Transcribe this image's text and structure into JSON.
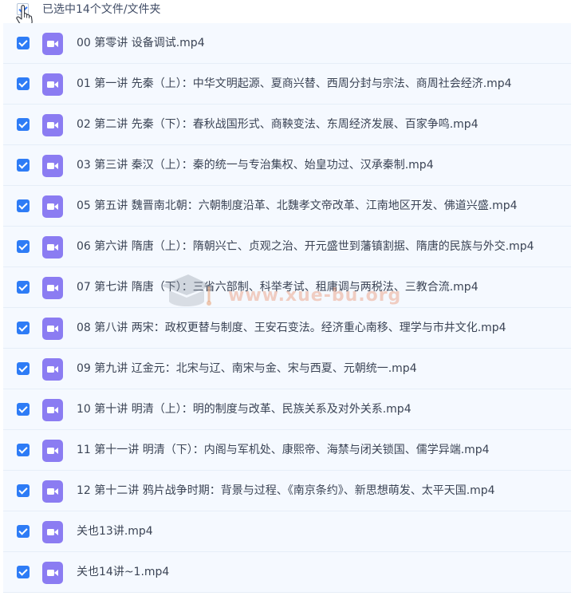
{
  "header": {
    "selection_text": "已选中14个文件/文件夹"
  },
  "files": [
    {
      "name": "00 第零讲 设备调试.mp4"
    },
    {
      "name": "01 第一讲 先秦（上）：中华文明起源、夏商兴替、西周分封与宗法、商周社会经济.mp4"
    },
    {
      "name": "02 第二讲 先秦（下）：春秋战国形式、商鞅变法、东周经济发展、百家争鸣.mp4"
    },
    {
      "name": "03 第三讲 秦汉（上）：秦的统一与专治集权、始皇功过、汉承秦制.mp4"
    },
    {
      "name": "05 第五讲 魏晋南北朝：六朝制度沿革、北魏孝文帝改革、江南地区开发、佛道兴盛.mp4"
    },
    {
      "name": "06 第六讲 隋唐（上）：隋朝兴亡、贞观之治、开元盛世到藩镇割据、隋唐的民族与外交.mp4"
    },
    {
      "name": "07 第七讲 隋唐（下）：三省六部制、科举考试、租庸调与两税法、三教合流.mp4"
    },
    {
      "name": "08 第八讲 两宋：政权更替与制度、王安石变法。经济重心南移、理学与市井文化.mp4"
    },
    {
      "name": "09 第九讲 辽金元：北宋与辽、南宋与金、宋与西夏、元朝统一.mp4"
    },
    {
      "name": "10 第十讲 明清（上）：明的制度与改革、民族关系及对外关系.mp4"
    },
    {
      "name": "11 第十一讲 明清（下）：内阁与军机处、康熙帝、海禁与闭关锁国、儒学异端.mp4"
    },
    {
      "name": "12 第十二讲 鸦片战争时期：背景与过程、《南京条约》、新思想萌发、太平天国.mp4"
    },
    {
      "name": "关也13讲.mp4"
    },
    {
      "name": "关也14讲~1.mp4"
    }
  ],
  "watermark": {
    "text": "www.xue-bu.org"
  },
  "colors": {
    "checkbox": "#2e7cf6",
    "file_icon": "#8b7cf2",
    "row_background": "#f5f9ff",
    "text": "#3b4455"
  },
  "icons": {
    "header_cursor": "hand-pointer-icon",
    "file": "video-file-icon"
  }
}
